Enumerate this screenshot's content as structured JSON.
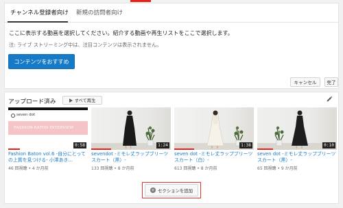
{
  "featured": {
    "tabs": [
      {
        "label": "チャンネル登録者向け"
      },
      {
        "label": "新規の訪問者向け"
      }
    ],
    "description": "ここに表示する動画を選択してください。紹介する動画や再生リストをここで選択します。",
    "note": "注: ライブ ストリーミング中は、注目コンテンツは表示されません。",
    "content_button": "コンテンツをおすすめ",
    "cancel_label": "キャンセル",
    "done_label": "完了"
  },
  "uploads": {
    "title": "アップロード済み",
    "play_all_label": "すべて再生",
    "videos": [
      {
        "title": "Fashion Baton vol.6 -自分にとっての上質を見つける- 小澤あき...",
        "meta": "46 回視聴 • 4 か月前",
        "duration": "0:58",
        "thumb_text_top": "seven dot",
        "thumb_text_main": "FASHION BATON INTERVIEW",
        "progress": 0.15
      },
      {
        "title": "sevendot -ミモレ丈ラップブリーツスカート（黒）-",
        "meta": "133 回視聴 • 8 か月前",
        "duration": "1:24",
        "progress": 0.25
      },
      {
        "title": "seven dot -ミモレ丈ラップブリーツスカート（白）-",
        "meta": "613 回視聴 • 8 か月前",
        "duration": "1:38",
        "progress": 0.25
      },
      {
        "title": "seven dot -ミモレ丈ラップブリーツスカート（黒）-",
        "meta": "65 回視聴 • 9 か月前",
        "duration": "0:10",
        "progress": 0.2
      }
    ]
  },
  "add_section_label": "セクションを追加",
  "icons": {
    "play": "play-icon",
    "edit": "pencil-icon",
    "add": "plus-icon"
  },
  "colors": {
    "accent": "#167ac6",
    "red": "#e62117"
  }
}
